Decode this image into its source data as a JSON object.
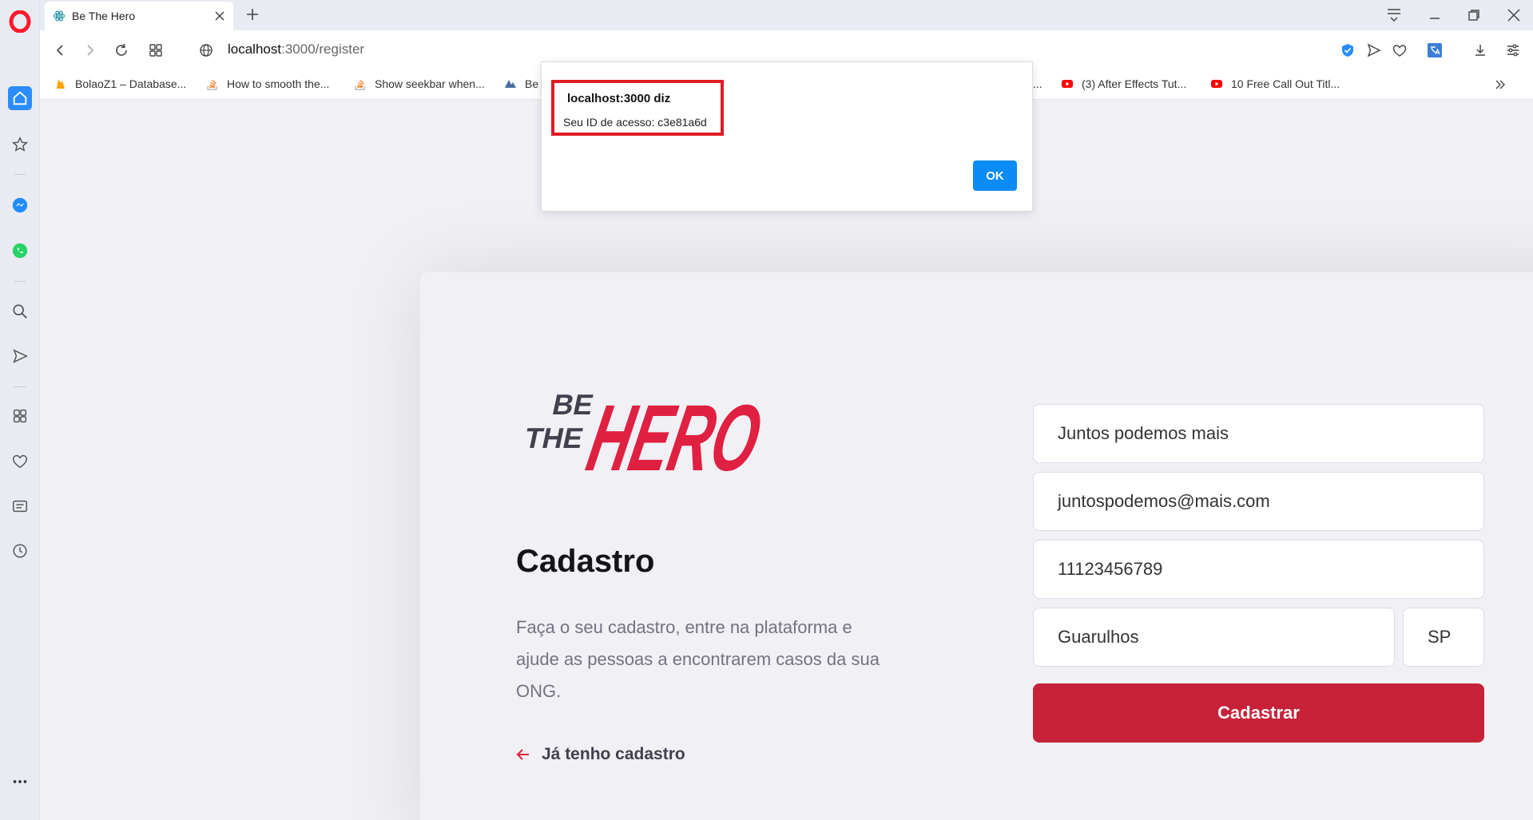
{
  "browser": {
    "tab_title": "Be The Hero",
    "url_host": "localhost",
    "url_path": ":3000/register",
    "bookmarks": [
      {
        "label": "BolaoZ1 – Database...",
        "icon": "firebase-icon"
      },
      {
        "label": "How to smooth the...",
        "icon": "stackoverflow-icon"
      },
      {
        "label": "Show seekbar when...",
        "icon": "stackoverflow-icon"
      },
      {
        "label": "Be",
        "icon": "bookmark-icon"
      },
      {
        "label": "...",
        "icon": ""
      },
      {
        "label": "(3) After Effects Tut...",
        "icon": "youtube-icon"
      },
      {
        "label": "10 Free Call Out Titl...",
        "icon": "youtube-icon"
      }
    ]
  },
  "dialog": {
    "title": "localhost:3000 diz",
    "message": "Seu ID de acesso: c3e81a6d",
    "ok_label": "OK"
  },
  "register": {
    "logo_be": "BE",
    "logo_the": "THE",
    "logo_hero": "HERO",
    "title": "Cadastro",
    "description": "Faça o seu cadastro, entre na plataforma e ajude as pessoas a encontrarem casos da sua ONG.",
    "back_link": "Já tenho cadastro",
    "fields": {
      "name": "Juntos podemos mais",
      "email": "juntospodemos@mais.com",
      "whatsapp": "11123456789",
      "city": "Guarulhos",
      "uf": "SP"
    },
    "submit_label": "Cadastrar"
  },
  "colors": {
    "brand_red": "#e02041",
    "button_red": "#c8223a",
    "opera_red": "#ff1b2d",
    "accent_blue": "#2a8cff"
  }
}
